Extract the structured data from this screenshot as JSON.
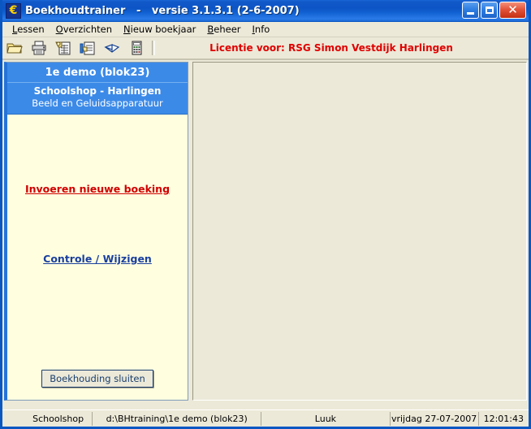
{
  "window": {
    "title": "Boekhoudtrainer   -   versie 3.1.3.1 (2-6-2007)",
    "icon": "euro-icon",
    "icon_glyph": "€",
    "controls": {
      "minimize_label": "Minimize",
      "maximize_label": "Maximize",
      "close_label": "Close",
      "close_glyph": "✕"
    },
    "colors": {
      "titlebar_blue": "#0d55c6",
      "close_red": "#c32f13",
      "panel_blue": "#3c8ae8",
      "panel_yellow": "#ffffe0",
      "face_beige": "#ece9d8",
      "license_red": "#e00000",
      "link_red": "#d00000",
      "link_blue": "#1a3f9e"
    }
  },
  "menu": {
    "items": [
      {
        "label": "Lessen",
        "accel": "L",
        "rest": "essen"
      },
      {
        "label": "Overzichten",
        "accel": "O",
        "rest": "verzichten"
      },
      {
        "label": "Nieuw boekjaar",
        "accel": "N",
        "rest": "ieuw boekjaar"
      },
      {
        "label": "Beheer",
        "accel": "B",
        "rest": "eheer"
      },
      {
        "label": "Info",
        "accel": "I",
        "rest": "nfo"
      }
    ]
  },
  "toolbar": {
    "buttons": [
      {
        "name": "open-folder-icon",
        "tip": "Openen"
      },
      {
        "name": "print-icon",
        "tip": "Afdrukken"
      },
      {
        "name": "report-edit-icon",
        "tip": "Overzicht bewerken"
      },
      {
        "name": "document-edit-icon",
        "tip": "Document bewerken"
      },
      {
        "name": "book-icon",
        "tip": "Boek"
      },
      {
        "name": "calculator-icon",
        "tip": "Rekenmachine"
      }
    ],
    "license_text": "Licentie voor: RSG Simon Vestdijk Harlingen"
  },
  "left_panel": {
    "title": "1e demo (blok23)",
    "company": "Schoolshop - Harlingen",
    "description": "Beeld en Geluidsapparatuur",
    "links": [
      {
        "name": "new-entry-link",
        "label": "Invoeren nieuwe boeking"
      },
      {
        "name": "check-modify-link",
        "label": "Controle / Wijzigen"
      }
    ],
    "close_button_label": "Boekhouding sluiten"
  },
  "status_bar": {
    "cells": [
      "Schoolshop",
      "d:\\BHtraining\\1e demo (blok23)",
      "Luuk",
      "vrijdag 27-07-2007",
      "12:01:43"
    ]
  }
}
